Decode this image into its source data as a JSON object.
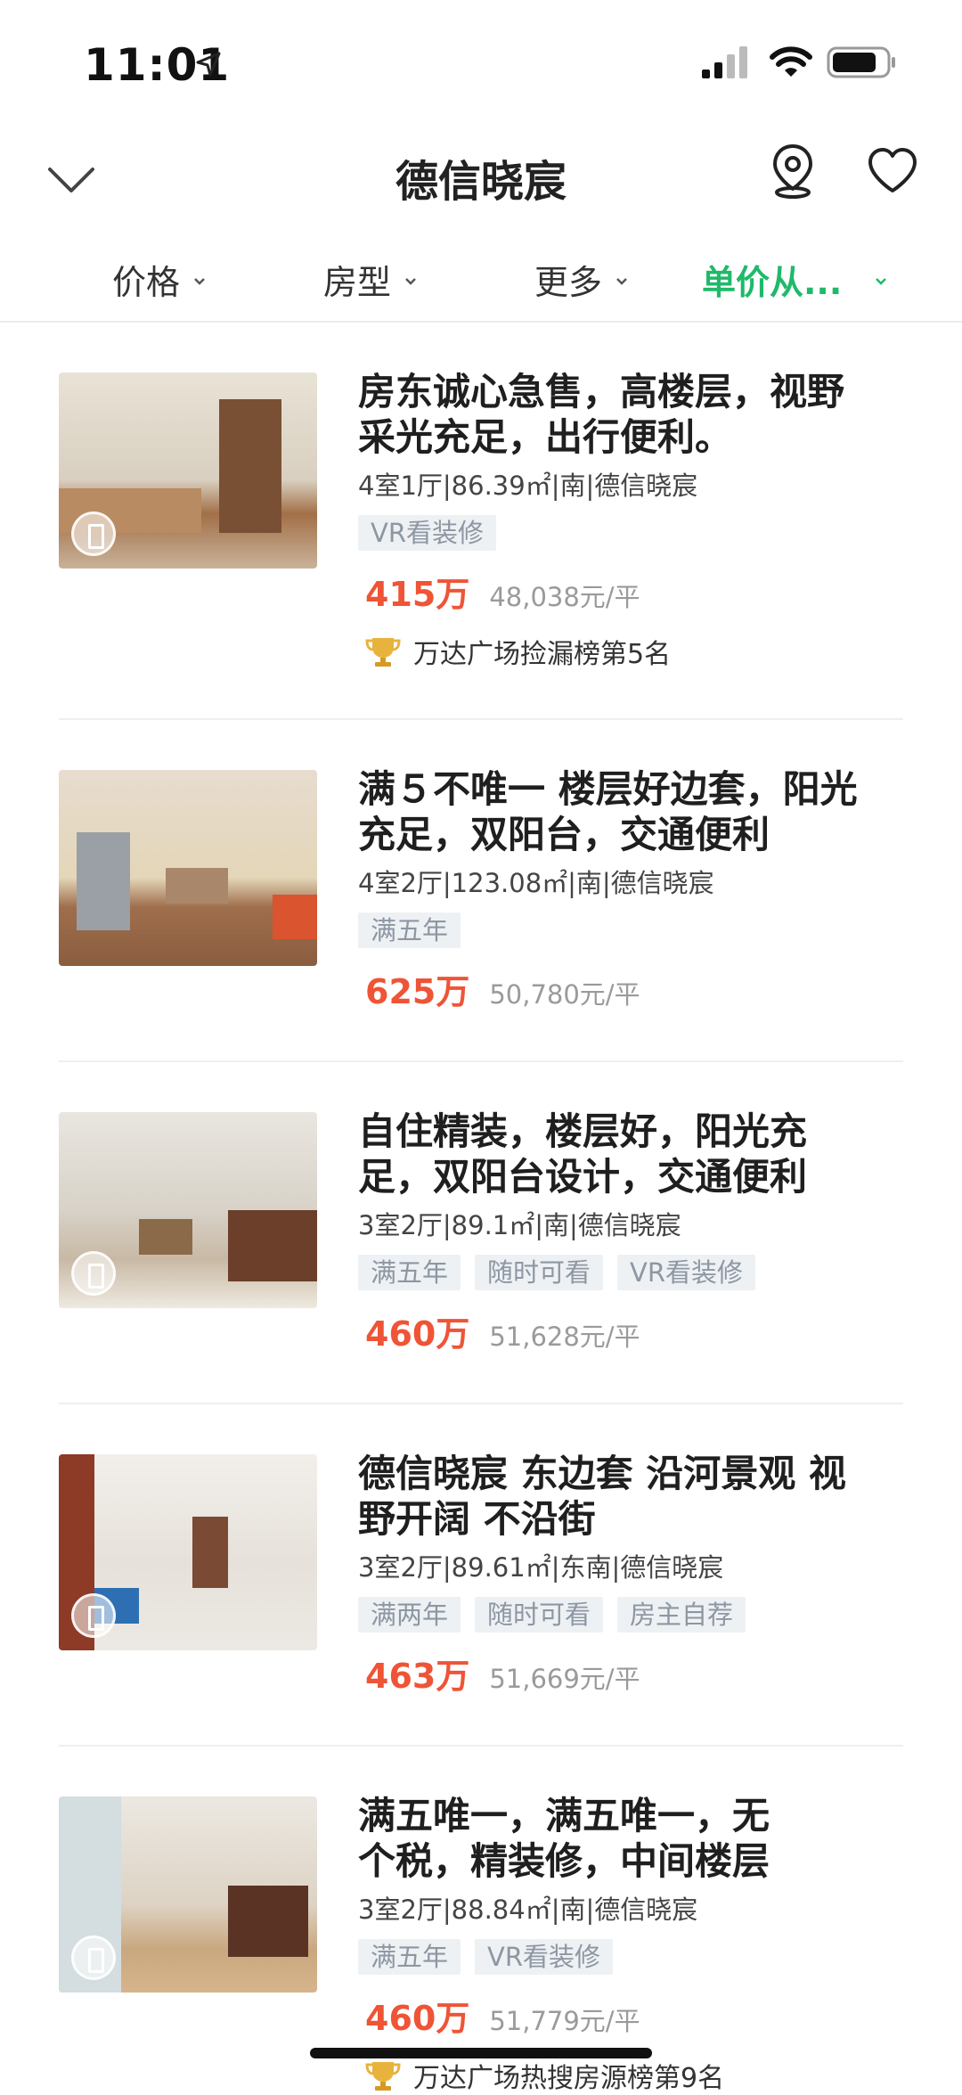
{
  "status": {
    "time": "11:01"
  },
  "nav": {
    "title": "德信晓宸"
  },
  "filters": [
    {
      "label": "价格",
      "active": false
    },
    {
      "label": "房型",
      "active": false
    },
    {
      "label": "更多",
      "active": false
    },
    {
      "label": "单价从...",
      "active": true
    }
  ],
  "listings": [
    {
      "title_line1": "房东诚心急售，高楼层，视野",
      "title_line2": "采光充足，出行便利。",
      "meta": "4室1厅|86.39㎡|南|德信晓宸",
      "tags": [
        "VR看装修"
      ],
      "price": "415万",
      "unit_price": "48,038元/平",
      "rank": "万达广场捡漏榜第5名"
    },
    {
      "title_line1": "满５不唯一 楼层好边套，阳光",
      "title_line2": "充足，双阳台，交通便利",
      "meta": "4室2厅|123.08㎡|南|德信晓宸",
      "tags": [
        "满五年"
      ],
      "price": "625万",
      "unit_price": "50,780元/平"
    },
    {
      "title_line1": "自住精装，楼层好，阳光充",
      "title_line2": "足，双阳台设计，交通便利",
      "meta": "3室2厅|89.1㎡|南|德信晓宸",
      "tags": [
        "满五年",
        "随时可看",
        "VR看装修"
      ],
      "price": "460万",
      "unit_price": "51,628元/平"
    },
    {
      "title_line1": "德信晓宸 东边套 沿河景观 视",
      "title_line2": "野开阔 不沿街",
      "meta": "3室2厅|89.61㎡|东南|德信晓宸",
      "tags": [
        "满两年",
        "随时可看",
        "房主自荐"
      ],
      "price": "463万",
      "unit_price": "51,669元/平"
    },
    {
      "title_line1": "满五唯一，满五唯一，无",
      "title_line2": "个税，精装修，中间楼层",
      "meta": "3室2厅|88.84㎡|南|德信晓宸",
      "tags": [
        "满五年",
        "VR看装修"
      ],
      "price": "460万",
      "unit_price": "51,779元/平",
      "rank": "万达广场热搜房源榜第9名"
    }
  ]
}
